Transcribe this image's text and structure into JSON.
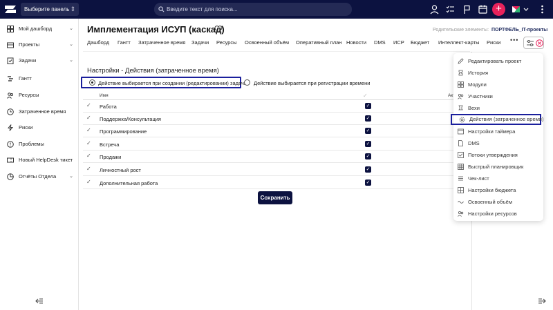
{
  "topbar": {
    "panel_select": "Выберите панель",
    "search_placeholder": "Введите текст для поиска...",
    "icons": [
      "user-icon",
      "tasks-icon",
      "flag-icon",
      "calendar-icon",
      "plus-icon",
      "brand-icon"
    ],
    "accent_color": "#e8225b",
    "bar_color": "#0c1240"
  },
  "sidebar": {
    "items": [
      {
        "label": "Мой дашборд",
        "icon": "dashboard-icon",
        "expandable": true
      },
      {
        "label": "Проекты",
        "icon": "projects-icon",
        "expandable": true
      },
      {
        "label": "Задачи",
        "icon": "tasks-icon",
        "expandable": true
      },
      {
        "label": "Гантт",
        "icon": "gantt-icon",
        "expandable": false
      },
      {
        "label": "Ресурсы",
        "icon": "resources-icon",
        "expandable": false
      },
      {
        "label": "Затраченное время",
        "icon": "clock-icon",
        "expandable": false
      },
      {
        "label": "Риски",
        "icon": "risks-icon",
        "expandable": false
      },
      {
        "label": "Проблемы",
        "icon": "problems-icon",
        "expandable": false
      },
      {
        "label": "Новый HelpDesk тикет",
        "icon": "helpdesk-icon",
        "expandable": false
      },
      {
        "label": "Отчёты Отдела",
        "icon": "reports-icon",
        "expandable": true
      }
    ]
  },
  "main": {
    "title": "Имплементация ИСУП (каскад)",
    "parent_label": "Родительские элементы:",
    "parent_link": "ПОРТФЕЛЬ_IT-проекты",
    "tabs": [
      "Дашборд",
      "Гантт",
      "Затраченное время",
      "Задачи",
      "Ресурсы",
      "Освоенный объём",
      "Оперативный план",
      "Новости",
      "DMS",
      "ИСР",
      "Бюджет",
      "Интеллект-карты",
      "Риски"
    ],
    "tab_more": "•••",
    "section_title": "Настройки - Действия (затраченное время)",
    "radio_options": [
      {
        "label": "Действие выбирается при создании (редактировании) задачи",
        "selected": true
      },
      {
        "label": "Действие выбирается при регистрации времени",
        "selected": false
      }
    ],
    "table": {
      "col_name": "Имя",
      "col_active": "Акт",
      "rows": [
        {
          "name": "Работа",
          "checked": true
        },
        {
          "name": "Поддержка/Консультация",
          "checked": true
        },
        {
          "name": "Программирование",
          "checked": true
        },
        {
          "name": "Встреча",
          "checked": true
        },
        {
          "name": "Продажи",
          "checked": true
        },
        {
          "name": "Личностный рост",
          "checked": true
        },
        {
          "name": "Дополнительная работа",
          "checked": true
        }
      ]
    },
    "save_label": "Сохранить"
  },
  "menu": {
    "items": [
      {
        "label": "Редактировать проект",
        "icon": "pencil-icon"
      },
      {
        "label": "История",
        "icon": "history-icon"
      },
      {
        "label": "Модули",
        "icon": "modules-icon"
      },
      {
        "label": "Участники",
        "icon": "participants-icon"
      },
      {
        "label": "Вехи",
        "icon": "milestones-icon"
      },
      {
        "label": "Действия (затраченное время)",
        "icon": "gear-icon",
        "highlighted": true
      },
      {
        "label": "Настройки таймера",
        "icon": "timer-icon"
      },
      {
        "label": "DMS",
        "icon": "document-icon"
      },
      {
        "label": "Потоки утверждения",
        "icon": "approval-icon"
      },
      {
        "label": "Быстрый планировщик",
        "icon": "grid-icon"
      },
      {
        "label": "Чек-лист",
        "icon": "checklist-icon"
      },
      {
        "label": "Настройки бюджета",
        "icon": "budget-icon"
      },
      {
        "label": "Освоенный объём",
        "icon": "earned-value-icon"
      },
      {
        "label": "Настройки ресурсов",
        "icon": "resources-settings-icon"
      }
    ]
  }
}
